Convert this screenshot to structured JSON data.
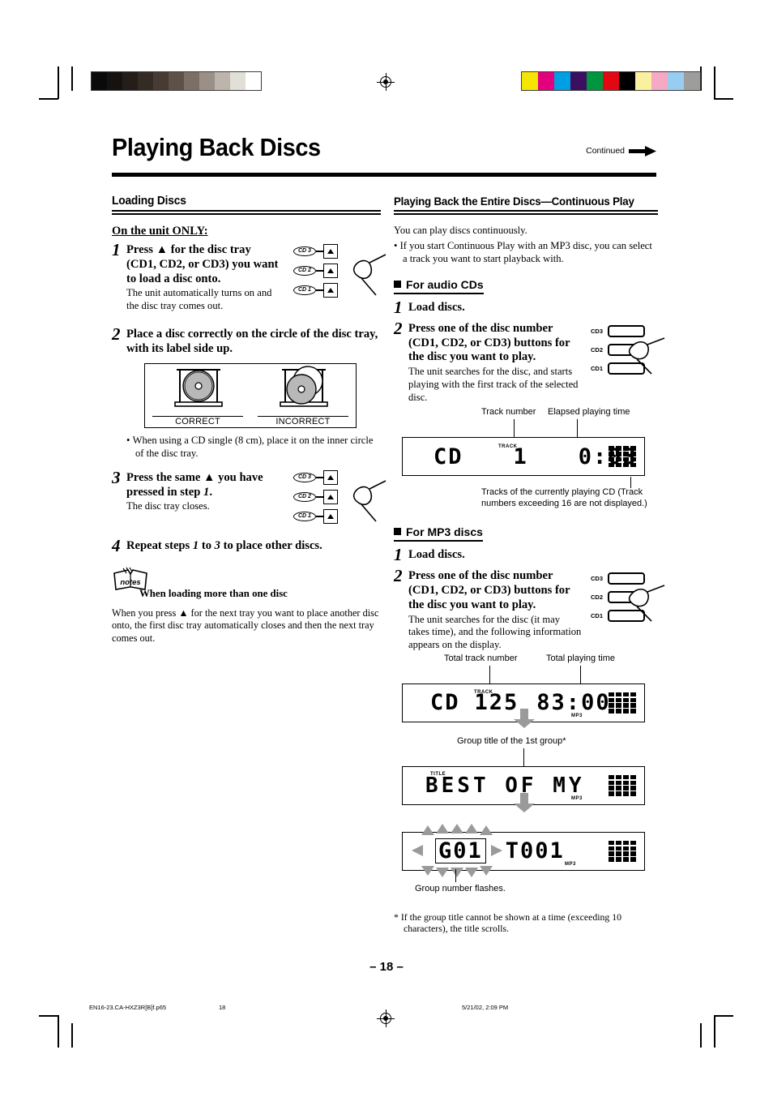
{
  "document": {
    "title": "Playing Back Discs",
    "continued_label": "Continued",
    "page_number": "– 18 –",
    "footer": {
      "filename": "EN16-23.CA-HXZ3R[B]f.p65",
      "page": "18",
      "timestamp": "5/21/02, 2:09 PM"
    }
  },
  "print_marks": {
    "gray_swatches": [
      "#0a0a0a",
      "#161210",
      "#241d19",
      "#352b25",
      "#473b33",
      "#5e5147",
      "#7b6f66",
      "#9b9087",
      "#bdb4ab",
      "#e2ded8",
      "#ffffff"
    ],
    "color_swatches": [
      "#f5e500",
      "#e2007f",
      "#009fe3",
      "#3b1060",
      "#009640",
      "#e30613",
      "#000000",
      "#faf0a0",
      "#f5a9c4",
      "#96cdf0",
      "#9d9d9c"
    ]
  },
  "left_column": {
    "section_title": "Loading Discs",
    "unit_only_label": "On the unit ONLY:",
    "steps": [
      {
        "num": "1",
        "head_parts": [
          "Press ",
          "▲",
          " for the disc tray (CD1, CD2, or CD3) you want to load a disc onto."
        ],
        "head": "Press ▲ for the disc tray (CD1, CD2, or CD3) you want to load a disc onto.",
        "desc": "The unit automatically turns on and the disc tray comes out."
      },
      {
        "num": "2",
        "head": "Place a disc correctly on the circle of the disc tray, with its label side up.",
        "bullet": "When using a CD single (8 cm), place it on the inner circle of the disc tray."
      },
      {
        "num": "3",
        "head_a": "Press the same ",
        "head_b": " you have pressed in step ",
        "head_c": "1",
        "head_d": ".",
        "desc": "The disc tray closes."
      },
      {
        "num": "4",
        "head_a": "Repeat steps ",
        "head_b": "1",
        "head_c": " to ",
        "head_d": "3",
        "head_e": " to place other discs."
      }
    ],
    "tray_diagram": {
      "correct_label": "CORRECT",
      "incorrect_label": "INCORRECT"
    },
    "eject_buttons": [
      "CD 3",
      "CD 2",
      "CD 1"
    ],
    "notes": {
      "icon_label": "notes",
      "title": "When loading more than one disc",
      "text_a": "When you press ",
      "text_b": " for the next tray you want to place another disc onto, the first disc tray automatically closes and then the next tray comes out."
    }
  },
  "right_column": {
    "section_title": "Playing Back the Entire Discs—Continuous Play",
    "intro": "You can play discs continuously.",
    "intro_bullet": "If you start Continuous Play with an MP3 disc, you can select a track you want to start playback with.",
    "audio_cds": {
      "heading": "For audio CDs",
      "steps": [
        {
          "num": "1",
          "head": "Load discs."
        },
        {
          "num": "2",
          "head": "Press one of the disc number (CD1, CD2, or CD3) buttons for the disc you want to play.",
          "desc": "The unit searches for the disc, and starts playing with the first track of the selected disc."
        }
      ],
      "display": {
        "callout_track": "Track number",
        "callout_elapsed": "Elapsed playing time",
        "callout_matrix": "Tracks of the currently playing CD (Track numbers exceeding 16 are not displayed.)",
        "text_cd": "CD",
        "track_indicator": "TRACK",
        "track_value": "1",
        "time_value": "0:03"
      }
    },
    "mp3_discs": {
      "heading": "For MP3 discs",
      "steps": [
        {
          "num": "1",
          "head": "Load discs."
        },
        {
          "num": "2",
          "head": "Press one of the disc number (CD1, CD2, or CD3) buttons for the disc you want to play.",
          "desc": "The unit searches for the disc (it may takes time), and the following information appears on the display."
        }
      ],
      "display_1": {
        "callout_total_track": "Total track number",
        "callout_total_time": "Total playing time",
        "text_cd": "CD",
        "track_indicator": "TRACK",
        "track_value": "125",
        "time_value": "83:00",
        "mp3_indicator": "MP3"
      },
      "display_2": {
        "callout_group_title": "Group title of the 1st group*",
        "title_indicator": "TITLE",
        "text_value": "BEST OF MY",
        "mp3_indicator": "MP3"
      },
      "display_3": {
        "group_value": "G01",
        "track_value": "T001",
        "mp3_indicator": "MP3",
        "caption": "Group number flashes."
      },
      "footnote": "*  If the group title cannot be shown at a time (exceeding 10 characters), the title scrolls."
    },
    "cd_buttons": [
      "CD3",
      "CD2",
      "CD1"
    ]
  }
}
